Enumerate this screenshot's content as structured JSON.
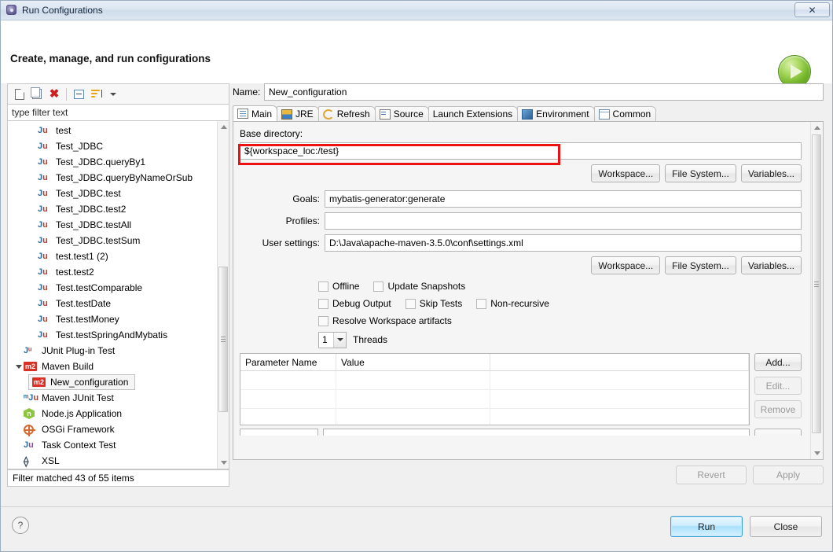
{
  "window": {
    "title": "Run Configurations",
    "icon": "run-config-icon",
    "close_label": "✕"
  },
  "header": {
    "title": "Create, manage, and run configurations",
    "run_icon": "play-icon"
  },
  "left_panel": {
    "toolbar": [
      {
        "name": "new-configuration-icon",
        "label": "New"
      },
      {
        "name": "duplicate-configuration-icon",
        "label": "Duplicate"
      },
      {
        "name": "delete-configuration-icon",
        "label": "Delete"
      },
      {
        "name": "collapse-all-icon",
        "label": "Collapse All"
      },
      {
        "name": "filter-icon",
        "label": "Filter"
      },
      {
        "name": "chevron-down-icon",
        "label": "Menu"
      }
    ],
    "filter": {
      "value": "type filter text",
      "placeholder": "type filter text"
    },
    "tree": [
      {
        "label": "test",
        "icon": "junit-icon",
        "depth": 2
      },
      {
        "label": "Test_JDBC",
        "icon": "junit-icon",
        "depth": 2
      },
      {
        "label": "Test_JDBC.queryBy1",
        "icon": "junit-icon",
        "depth": 2
      },
      {
        "label": "Test_JDBC.queryByNameOrSub",
        "icon": "junit-icon",
        "depth": 2
      },
      {
        "label": "Test_JDBC.test",
        "icon": "junit-icon",
        "depth": 2
      },
      {
        "label": "Test_JDBC.test2",
        "icon": "junit-icon",
        "depth": 2
      },
      {
        "label": "Test_JDBC.testAll",
        "icon": "junit-icon",
        "depth": 2
      },
      {
        "label": "Test_JDBC.testSum",
        "icon": "junit-icon",
        "depth": 2
      },
      {
        "label": "test.test1 (2)",
        "icon": "junit-icon",
        "depth": 2
      },
      {
        "label": "test.test2",
        "icon": "junit-icon",
        "depth": 2
      },
      {
        "label": "Test.testComparable",
        "icon": "junit-icon",
        "depth": 2
      },
      {
        "label": "Test.testDate",
        "icon": "junit-icon",
        "depth": 2
      },
      {
        "label": "Test.testMoney",
        "icon": "junit-icon",
        "depth": 2
      },
      {
        "label": "Test.testSpringAndMybatis",
        "icon": "junit-icon",
        "depth": 2
      },
      {
        "label": "JUnit Plug-in Test",
        "icon": "junit-plugin-icon",
        "depth": 1
      },
      {
        "label": "Maven Build",
        "icon": "maven-icon",
        "depth": 1,
        "expanded": true
      },
      {
        "label": "New_configuration",
        "icon": "maven-icon",
        "depth": 2,
        "selected": true
      },
      {
        "label": "Maven JUnit Test",
        "icon": "maven-junit-icon",
        "depth": 1
      },
      {
        "label": "Node.js Application",
        "icon": "nodejs-icon",
        "depth": 1
      },
      {
        "label": "OSGi Framework",
        "icon": "osgi-icon",
        "depth": 1
      },
      {
        "label": "Task Context Test",
        "icon": "task-context-icon",
        "depth": 1
      },
      {
        "label": "XSL",
        "icon": "xsl-icon",
        "depth": 1
      }
    ],
    "status": "Filter matched 43 of 55 items"
  },
  "right_panel": {
    "name_label": "Name:",
    "name_value": "New_configuration",
    "tabs": [
      {
        "label": "Main",
        "icon": "main-tab-icon",
        "active": true
      },
      {
        "label": "JRE",
        "icon": "jre-tab-icon",
        "active": false
      },
      {
        "label": "Refresh",
        "icon": "refresh-tab-icon",
        "active": false
      },
      {
        "label": "Source",
        "icon": "source-tab-icon",
        "active": false
      },
      {
        "label": "Launch Extensions",
        "icon": "launch-extensions-tab-icon",
        "active": false
      },
      {
        "label": "Environment",
        "icon": "environment-tab-icon",
        "active": false
      },
      {
        "label": "Common",
        "icon": "common-tab-icon",
        "active": false
      }
    ],
    "main_tab": {
      "base_directory_label": "Base directory:",
      "base_directory_value": "${workspace_loc:/test}",
      "base_directory_highlight_color": "#ee1111",
      "dir_buttons": [
        {
          "label": "Workspace...",
          "name": "base-dir-workspace-button"
        },
        {
          "label": "File System...",
          "name": "base-dir-filesystem-button"
        },
        {
          "label": "Variables...",
          "name": "base-dir-variables-button"
        }
      ],
      "fields": [
        {
          "label": "Goals:",
          "value": "mybatis-generator:generate",
          "name": "goals"
        },
        {
          "label": "Profiles:",
          "value": "",
          "name": "profiles"
        },
        {
          "label": "User settings:",
          "value": "D:\\Java\\apache-maven-3.5.0\\conf\\settings.xml",
          "name": "user-settings"
        }
      ],
      "settings_buttons": [
        {
          "label": "Workspace...",
          "name": "user-settings-workspace-button"
        },
        {
          "label": "File System...",
          "name": "user-settings-filesystem-button"
        },
        {
          "label": "Variables...",
          "name": "user-settings-variables-button"
        }
      ],
      "checkbox_rows": [
        [
          {
            "label": "Offline",
            "checked": false,
            "name": "offline"
          },
          {
            "label": "Update Snapshots",
            "checked": false,
            "name": "update-snapshots"
          }
        ],
        [
          {
            "label": "Debug Output",
            "checked": false,
            "name": "debug-output"
          },
          {
            "label": "Skip Tests",
            "checked": false,
            "name": "skip-tests"
          },
          {
            "label": "Non-recursive",
            "checked": false,
            "name": "non-recursive"
          }
        ],
        [
          {
            "label": "Resolve Workspace artifacts",
            "checked": false,
            "name": "resolve-workspace-artifacts"
          }
        ]
      ],
      "threads": {
        "value": "1",
        "label": "Threads"
      },
      "parameters_table": {
        "headers": [
          "Parameter Name",
          "Value",
          ""
        ],
        "rows": [],
        "empty_row_count": 3
      },
      "parameter_buttons": [
        {
          "label": "Add...",
          "enabled": true,
          "name": "add-parameter-button"
        },
        {
          "label": "Edit...",
          "enabled": false,
          "name": "edit-parameter-button"
        },
        {
          "label": "Remove",
          "enabled": false,
          "name": "remove-parameter-button"
        }
      ]
    },
    "revert_label": "Revert",
    "apply_label": "Apply"
  },
  "footer": {
    "help_label": "?",
    "run_label": "Run",
    "close_label": "Close"
  }
}
